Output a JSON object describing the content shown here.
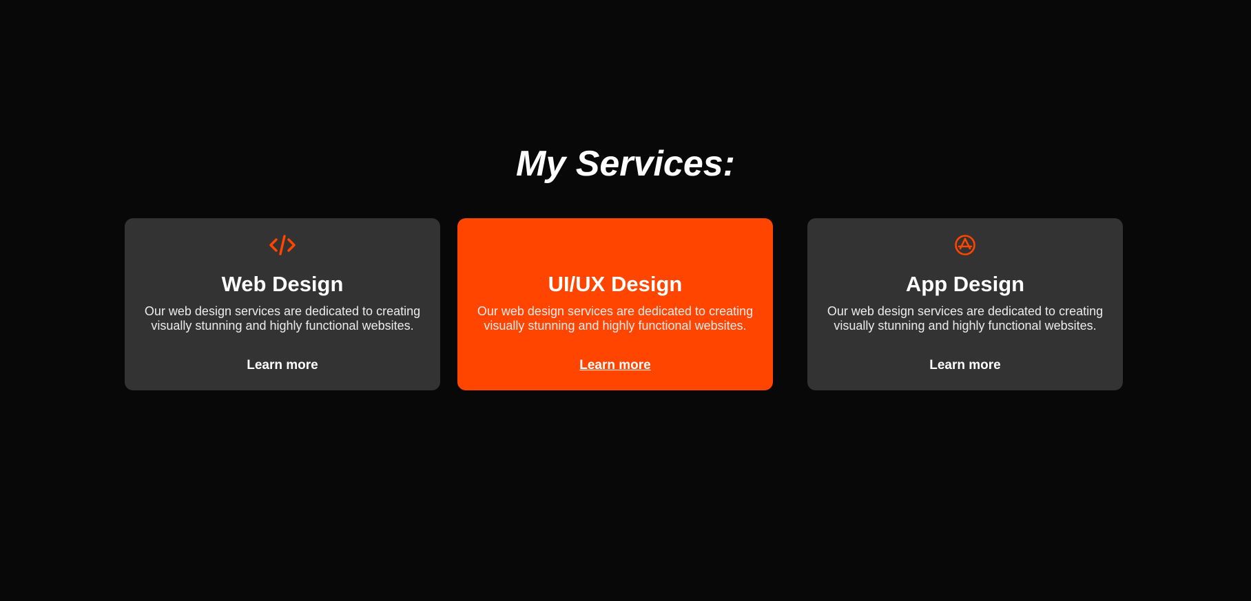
{
  "section": {
    "title": "My Services:"
  },
  "colors": {
    "background": "#080808",
    "card": "#333333",
    "accent": "#ff4500",
    "text": "#ffffff"
  },
  "cards": [
    {
      "icon": "code-icon",
      "title": "Web Design",
      "description": "Our web design services are dedicated to creating visually stunning and highly functional websites.",
      "link": "Learn more",
      "highlighted": false
    },
    {
      "icon": "",
      "title": "UI/UX Design",
      "description": "Our web design services are dedicated to creating visually stunning and highly functional websites.",
      "link": "Learn more",
      "highlighted": true
    },
    {
      "icon": "app-store-icon",
      "title": "App Design",
      "description": "Our web design services are dedicated to creating visually stunning and highly functional websites.",
      "link": "Learn more",
      "highlighted": false
    }
  ]
}
